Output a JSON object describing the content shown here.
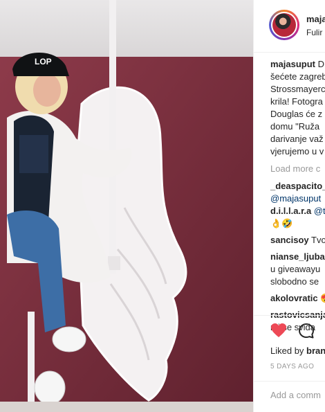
{
  "post": {
    "header_username": "maja",
    "header_subtitle": "Fulir",
    "caption_user": "majasuput",
    "caption_lines": [
      "D",
      "šećete zagreb",
      "Strossmayerc",
      "krila! Fotogra",
      "Douglas će z",
      "domu \"Ruža",
      "darivanje važ",
      "vjerujemo u v"
    ],
    "load_more": "Load more c",
    "comments": [
      {
        "user": "_deaspacito_",
        "lines": [
          {
            "text": "@majasuput",
            "mention": true
          }
        ]
      },
      {
        "user": "d.i.l.l.a.r.a",
        "inline_text": " @t",
        "lines": [
          {
            "text": "👌🤣",
            "mention": false
          }
        ]
      },
      {
        "user": "sancisoy",
        "inline_text": " Tvo",
        "lines": []
      },
      {
        "user": "nianse_ljuba",
        "inline_text": "",
        "lines": [
          {
            "text": "u giveawayu",
            "mention": false
          },
          {
            "text": "slobodno se",
            "mention": false
          }
        ]
      },
      {
        "user": "akolovratic",
        "inline_text": " 😍",
        "lines": []
      },
      {
        "user": "rastovicsanja",
        "inline_text": "",
        "lines": [
          {
            "text": "mi se svida",
            "mention": false
          }
        ]
      }
    ],
    "liked_by_prefix": "Liked by ",
    "liked_by_user": "bran",
    "timestamp": "5 DAYS AGO",
    "add_comment_placeholder": "Add a comm"
  },
  "photo": {
    "cap_text": "LOP",
    "colors": {
      "wall": "#7a2c3b",
      "wing": "#f4f1f2",
      "jeans": "#3d6ea6",
      "sweater": "#1a2433"
    }
  },
  "icons": {
    "like": "heart-icon",
    "comment": "comment-bubble-icon"
  },
  "colors": {
    "heart": "#ed4956",
    "mention": "#003569",
    "muted": "#999999"
  }
}
